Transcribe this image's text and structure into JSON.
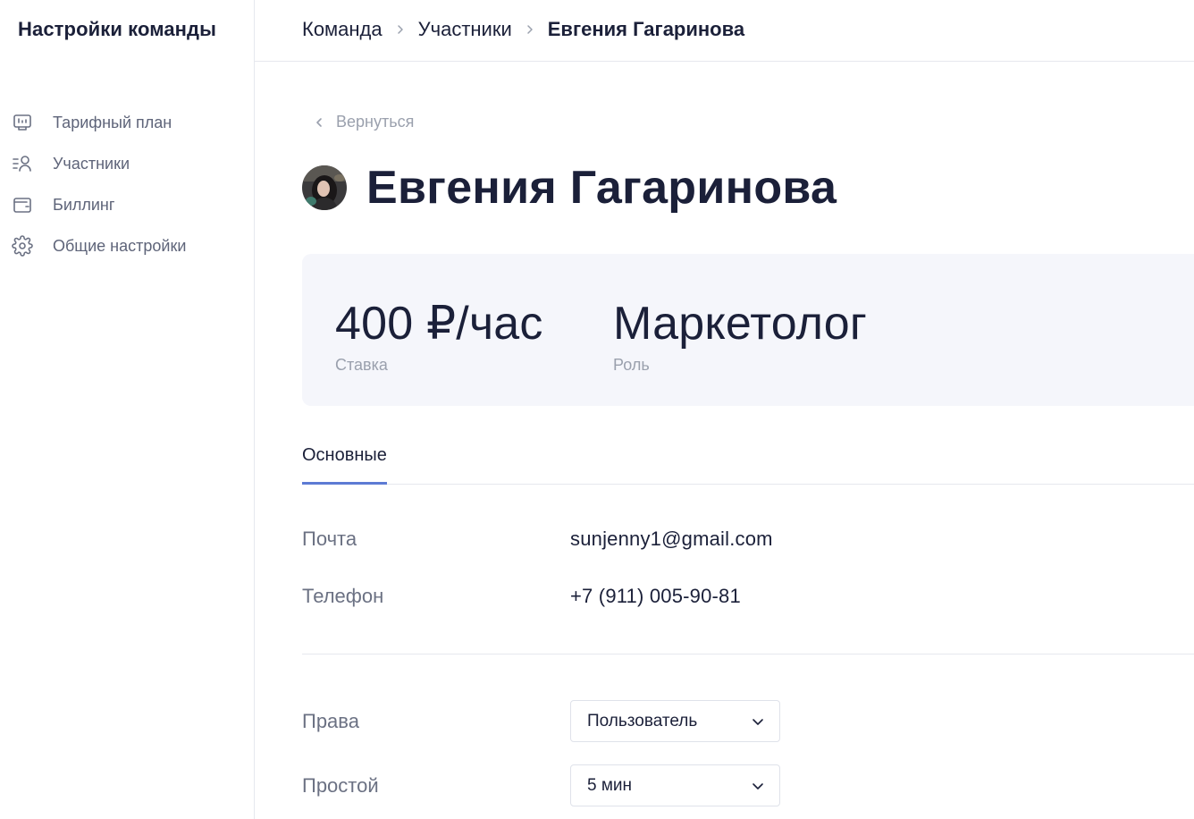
{
  "sidebar": {
    "title": "Настройки команды",
    "items": [
      {
        "label": "Тарифный план",
        "icon": "pricing-plan-icon"
      },
      {
        "label": "Участники",
        "icon": "members-icon"
      },
      {
        "label": "Биллинг",
        "icon": "wallet-icon"
      },
      {
        "label": "Общие настройки",
        "icon": "gear-icon"
      }
    ]
  },
  "breadcrumb": {
    "items": [
      "Команда",
      "Участники"
    ],
    "current": "Евгения Гагаринова"
  },
  "back_label": "Вернуться",
  "profile": {
    "name": "Евгения Гагаринова",
    "avatar": "user-avatar-photo"
  },
  "stats": {
    "rate": {
      "value": "400 ₽/час",
      "label": "Ставка"
    },
    "role": {
      "value": "Маркетолог",
      "label": "Роль"
    }
  },
  "tabs": [
    {
      "label": "Основные",
      "active": true
    }
  ],
  "contacts": {
    "email": {
      "label": "Почта",
      "value": "sunjenny1@gmail.com"
    },
    "phone": {
      "label": "Телефон",
      "value": "+7 (911) 005-90-81"
    }
  },
  "settings": {
    "rights": {
      "label": "Права",
      "value": "Пользователь"
    },
    "idle": {
      "label": "Простой",
      "value": "5 мин"
    }
  },
  "colors": {
    "accent": "#5d7bd4",
    "text": "#1b2039",
    "muted": "#9aa0ad",
    "panel": "#f5f6fb"
  }
}
